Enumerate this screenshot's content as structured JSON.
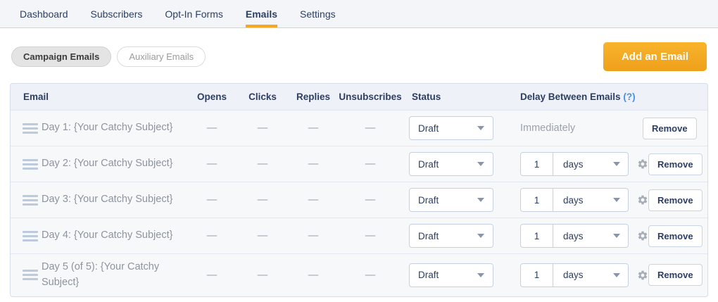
{
  "nav": {
    "tabs": [
      {
        "label": "Dashboard",
        "active": false
      },
      {
        "label": "Subscribers",
        "active": false
      },
      {
        "label": "Opt-In Forms",
        "active": false
      },
      {
        "label": "Emails",
        "active": true
      },
      {
        "label": "Settings",
        "active": false
      }
    ]
  },
  "toolbar": {
    "filters": [
      {
        "label": "Campaign Emails",
        "active": true
      },
      {
        "label": "Auxiliary Emails",
        "active": false
      }
    ],
    "add_button_label": "Add an Email"
  },
  "table": {
    "headers": {
      "email": "Email",
      "opens": "Opens",
      "clicks": "Clicks",
      "replies": "Replies",
      "unsubscribes": "Unsubscribes",
      "status": "Status",
      "delay": "Delay Between Emails",
      "delay_help": "(?)"
    },
    "rows": [
      {
        "email": "Day 1: {Your Catchy Subject}",
        "opens": "—",
        "clicks": "—",
        "replies": "—",
        "unsubscribes": "—",
        "status": "Draft",
        "delay_type": "immediately",
        "delay_text": "Immediately",
        "remove_label": "Remove"
      },
      {
        "email": "Day 2: {Your Catchy Subject}",
        "opens": "—",
        "clicks": "—",
        "replies": "—",
        "unsubscribes": "—",
        "status": "Draft",
        "delay_type": "interval",
        "delay_value": "1",
        "delay_unit": "days",
        "remove_label": "Remove"
      },
      {
        "email": "Day 3: {Your Catchy Subject}",
        "opens": "—",
        "clicks": "—",
        "replies": "—",
        "unsubscribes": "—",
        "status": "Draft",
        "delay_type": "interval",
        "delay_value": "1",
        "delay_unit": "days",
        "remove_label": "Remove"
      },
      {
        "email": "Day 4: {Your Catchy Subject}",
        "opens": "—",
        "clicks": "—",
        "replies": "—",
        "unsubscribes": "—",
        "status": "Draft",
        "delay_type": "interval",
        "delay_value": "1",
        "delay_unit": "days",
        "remove_label": "Remove"
      },
      {
        "email": "Day 5 (of 5): {Your Catchy Subject}",
        "opens": "—",
        "clicks": "—",
        "replies": "—",
        "unsubscribes": "—",
        "status": "Draft",
        "delay_type": "interval",
        "delay_value": "1",
        "delay_unit": "days",
        "remove_label": "Remove"
      }
    ]
  },
  "icons": {
    "drag_handle": "drag-handle-icon",
    "gear": "gear-icon",
    "caret": "chevron-down-icon"
  },
  "colors": {
    "accent_orange": "#f5a81f",
    "navy_text": "#2d3e63",
    "link_blue": "#4a90e2",
    "muted_text": "#8d949e",
    "row_bg": "#f7f8fa",
    "header_bg": "#eff1f8",
    "table_border": "#d6dcea"
  }
}
